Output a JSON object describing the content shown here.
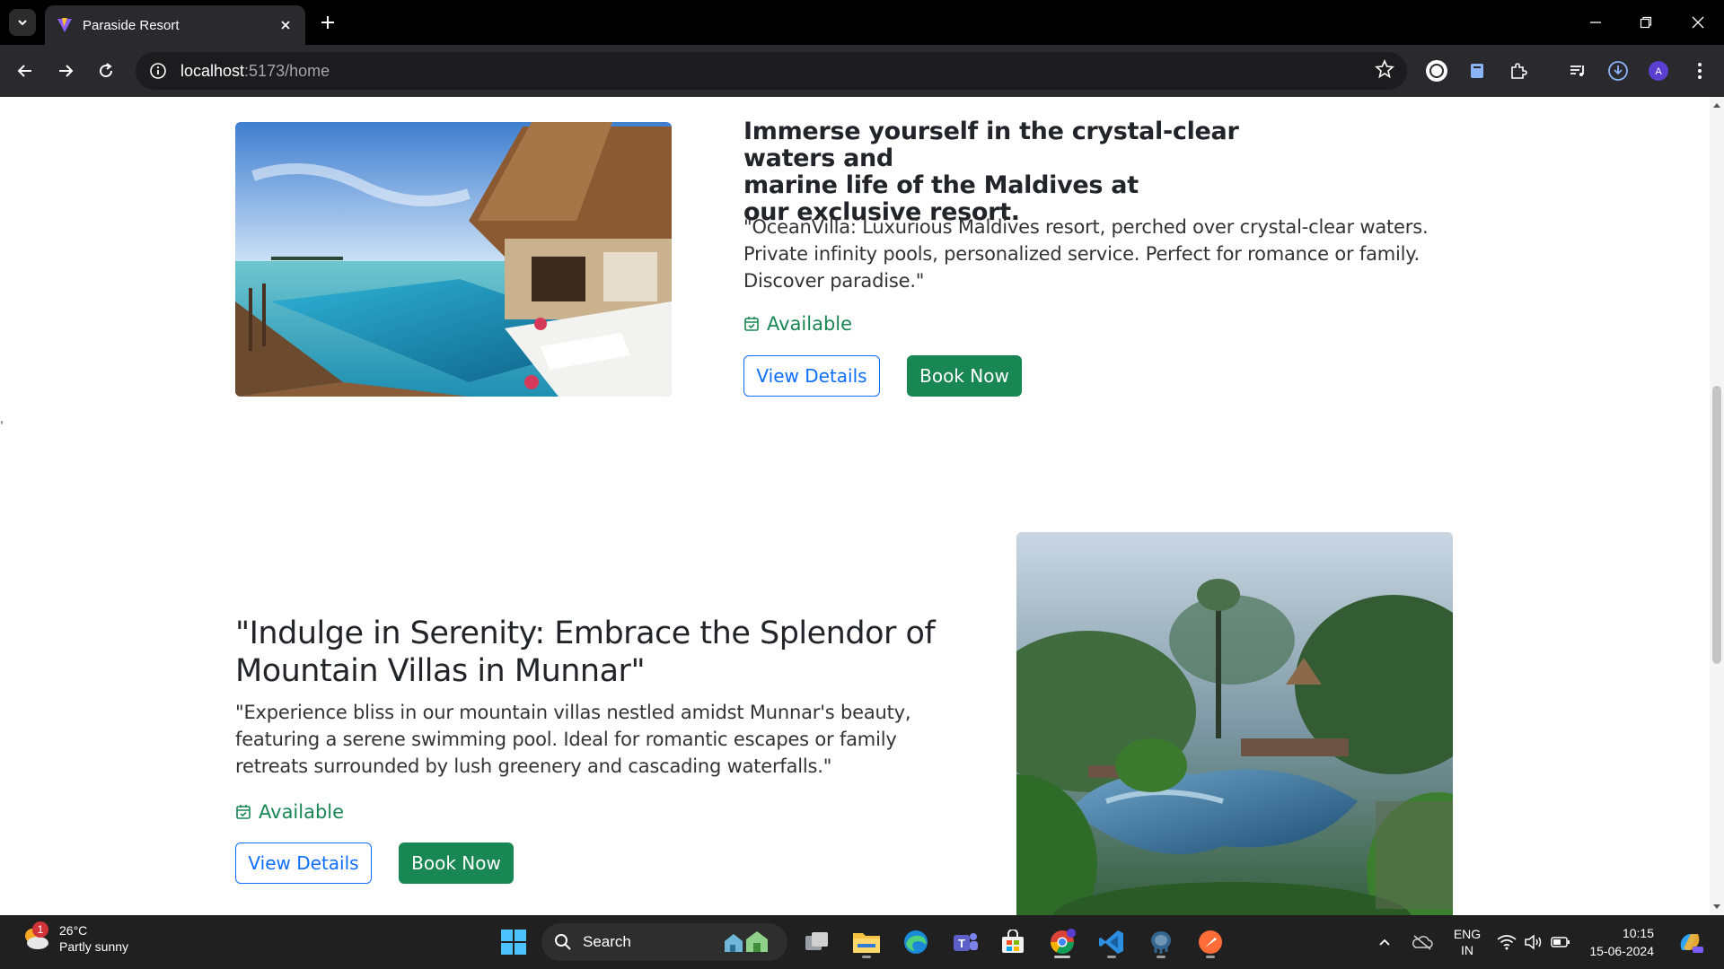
{
  "browser": {
    "tab_title": "Paraside Resort",
    "url_host": "localhost",
    "url_rest": ":5173/home"
  },
  "page": {
    "stray_mark": ",",
    "section1": {
      "heading_lines": [
        "Immerse yourself in the crystal-clear waters and",
        "marine life of the Maldives at",
        "our exclusive resort."
      ],
      "description": "\"OceanVilla: Luxurious Maldives resort, perched over crystal-clear waters. Private infinity pools, personalized service. Perfect for romance or family. Discover paradise.\"",
      "availability": "Available",
      "view_label": "View Details",
      "book_label": "Book Now"
    },
    "section2": {
      "heading": "\"Indulge in Serenity: Embrace the Splendor of Mountain Villas in Munnar\"",
      "description": "\"Experience bliss in our mountain villas nestled amidst Munnar's beauty, featuring a serene swimming pool. Ideal for romantic escapes or family retreats surrounded by lush greenery and cascading waterfalls.\"",
      "availability": "Available",
      "view_label": "View Details",
      "book_label": "Book Now"
    }
  },
  "taskbar": {
    "weather_temp": "26°C",
    "weather_desc": "Partly sunny",
    "weather_badge": "1",
    "search_label": "Search",
    "lang_top": "ENG",
    "lang_bottom": "IN",
    "time": "10:15",
    "date": "15-06-2024"
  },
  "colors": {
    "available_green": "#198754",
    "outline_blue": "#0d6efd",
    "book_green": "#198754"
  }
}
